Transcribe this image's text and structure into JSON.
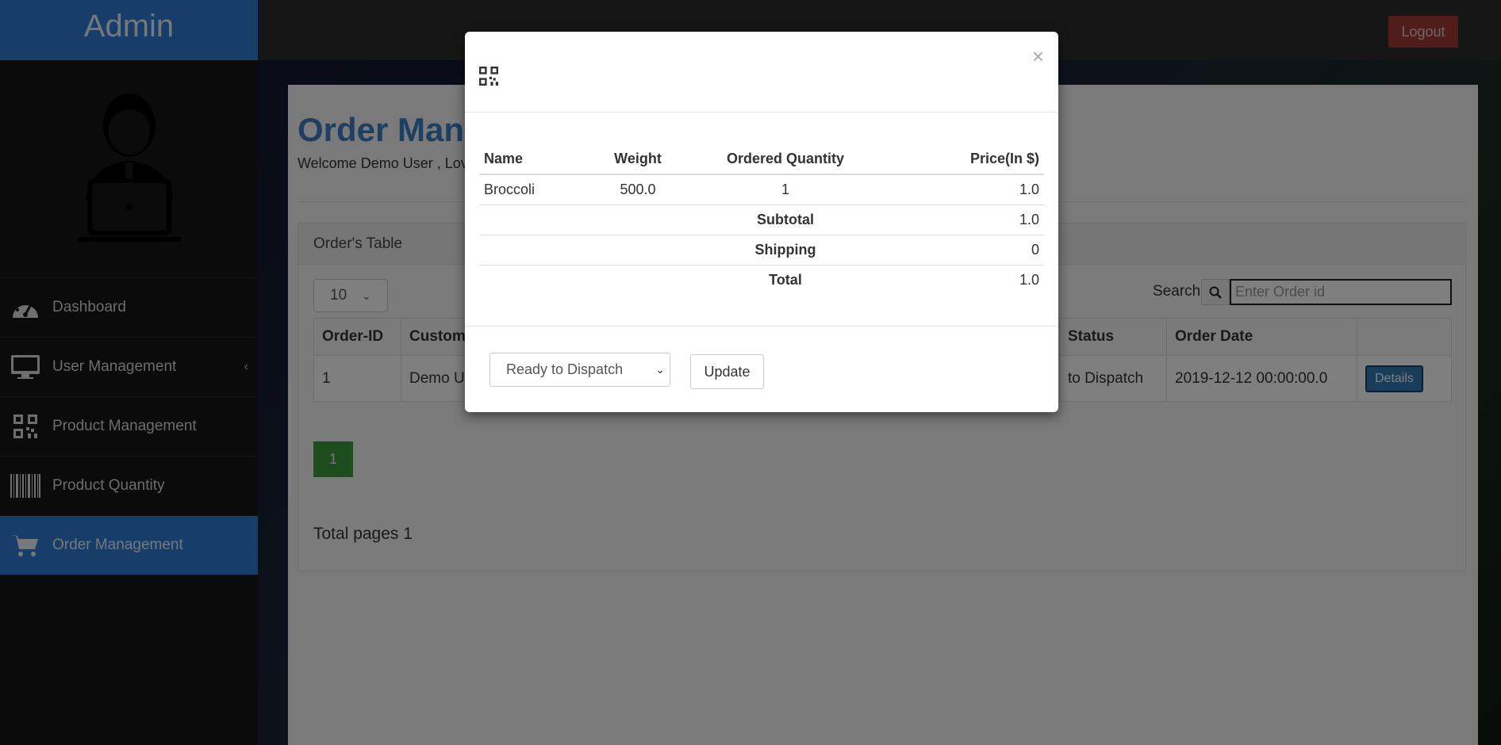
{
  "sidebar": {
    "brand": "Admin",
    "items": [
      {
        "label": "Dashboard",
        "icon": "dashboard-icon"
      },
      {
        "label": "User Management",
        "icon": "monitor-icon"
      },
      {
        "label": "Product Management",
        "icon": "qrcode-icon"
      },
      {
        "label": "Product Quantity",
        "icon": "barcode-icon"
      },
      {
        "label": "Order Management",
        "icon": "cart-icon"
      }
    ],
    "active": "Order Management"
  },
  "topbar": {
    "logout_label": "Logout"
  },
  "main": {
    "title": "Order Mana",
    "welcome": "Welcome Demo User , Lov",
    "card_title": "Order's Table",
    "page_length": "10",
    "search_label": "Search",
    "search_placeholder": "Enter Order id",
    "table": {
      "headers": [
        "Order-ID",
        "Custome",
        "Status",
        "Order Date",
        ""
      ],
      "rows": [
        {
          "id": "1",
          "customer": "Demo Us",
          "status": "to Dispatch",
          "date": "2019-12-12 00:00:00.0",
          "action": "Details"
        }
      ]
    },
    "current_page": "1",
    "total_pages": "Total pages 1"
  },
  "modal": {
    "close": "×",
    "headers": {
      "name": "Name",
      "weight": "Weight",
      "qty": "Ordered Quantity",
      "price": "Price(In $)"
    },
    "items": [
      {
        "name": "Broccoli",
        "weight": "500.0",
        "qty": "1",
        "price": "1.0"
      }
    ],
    "subtotal_label": "Subtotal",
    "subtotal": "1.0",
    "shipping_label": "Shipping",
    "shipping": "0",
    "total_label": "Total",
    "total": "1.0",
    "status_selected": "Ready to Dispatch",
    "update_label": "Update"
  },
  "colors": {
    "sidebar_active": "#2f7dd1",
    "logout": "#a13a37",
    "title": "#3d7cc4",
    "pagination": "#3b9a3b"
  }
}
